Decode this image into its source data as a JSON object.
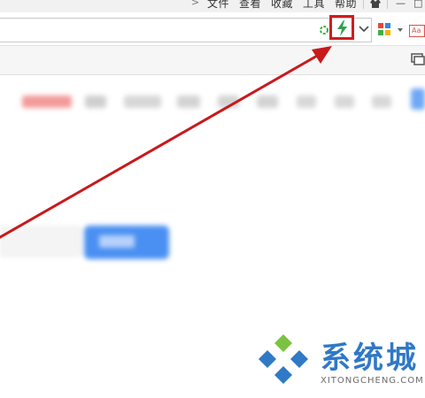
{
  "menubar": {
    "arrow": ">",
    "items": [
      "文件",
      "查看",
      "收藏",
      "工具",
      "帮助"
    ],
    "window_buttons": [
      "—",
      "□"
    ]
  },
  "toolbar": {
    "address_value": "",
    "translate_label": "Aa"
  },
  "colors": {
    "highlight_red": "#d11c1c",
    "lightning_green": "#2ea44f",
    "logo_blue": "#2f79c6",
    "logo_green": "#7cc242",
    "blurred_button_blue": "#4a90f2"
  },
  "icons": {
    "refresh": "refresh-icon",
    "lightning": "lightning-icon",
    "dropdown": "chevron-down-icon",
    "apps": "apps-icon",
    "translate": "translate-icon",
    "screen": "screen-icon"
  },
  "watermark": {
    "brand": "系统城",
    "domain": "XITONGCHENG.COM"
  }
}
